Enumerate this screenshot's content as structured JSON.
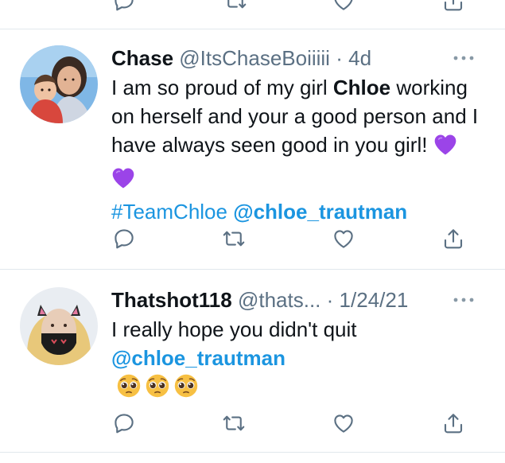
{
  "colors": {
    "text": "#0f1419",
    "muted": "#5b7083",
    "link": "#1b95e0",
    "divider": "#e1e8ed",
    "heart_emoji": "#9b44e8",
    "pleading_face": "#f7c043"
  },
  "previous_tweet": {
    "actions": [
      "reply-icon",
      "retweet-icon",
      "like-icon",
      "share-icon"
    ]
  },
  "tweets": [
    {
      "author_name": "Chase",
      "handle": "@ItsChaseBoiiiii",
      "separator": "·",
      "time": "4d",
      "text_before": "I am so proud of my girl ",
      "text_bold": "Chloe",
      "text_after": " working on herself and your a good person and I have always seen good in you girl! ",
      "emojis": [
        "purple-heart",
        "purple-heart"
      ],
      "hashtag": "#TeamChloe",
      "mention": "@chloe_trautman",
      "actions": [
        "reply-icon",
        "retweet-icon",
        "like-icon",
        "share-icon"
      ]
    },
    {
      "author_name": "Thatshot118",
      "handle": "@thats...",
      "separator": "·",
      "time": "1/24/21",
      "text": "I really hope you didn't quit",
      "mention": "@chloe_trautman",
      "emojis": [
        "pleading-face",
        "pleading-face",
        "pleading-face"
      ],
      "actions": [
        "reply-icon",
        "retweet-icon",
        "like-icon",
        "share-icon"
      ]
    }
  ]
}
